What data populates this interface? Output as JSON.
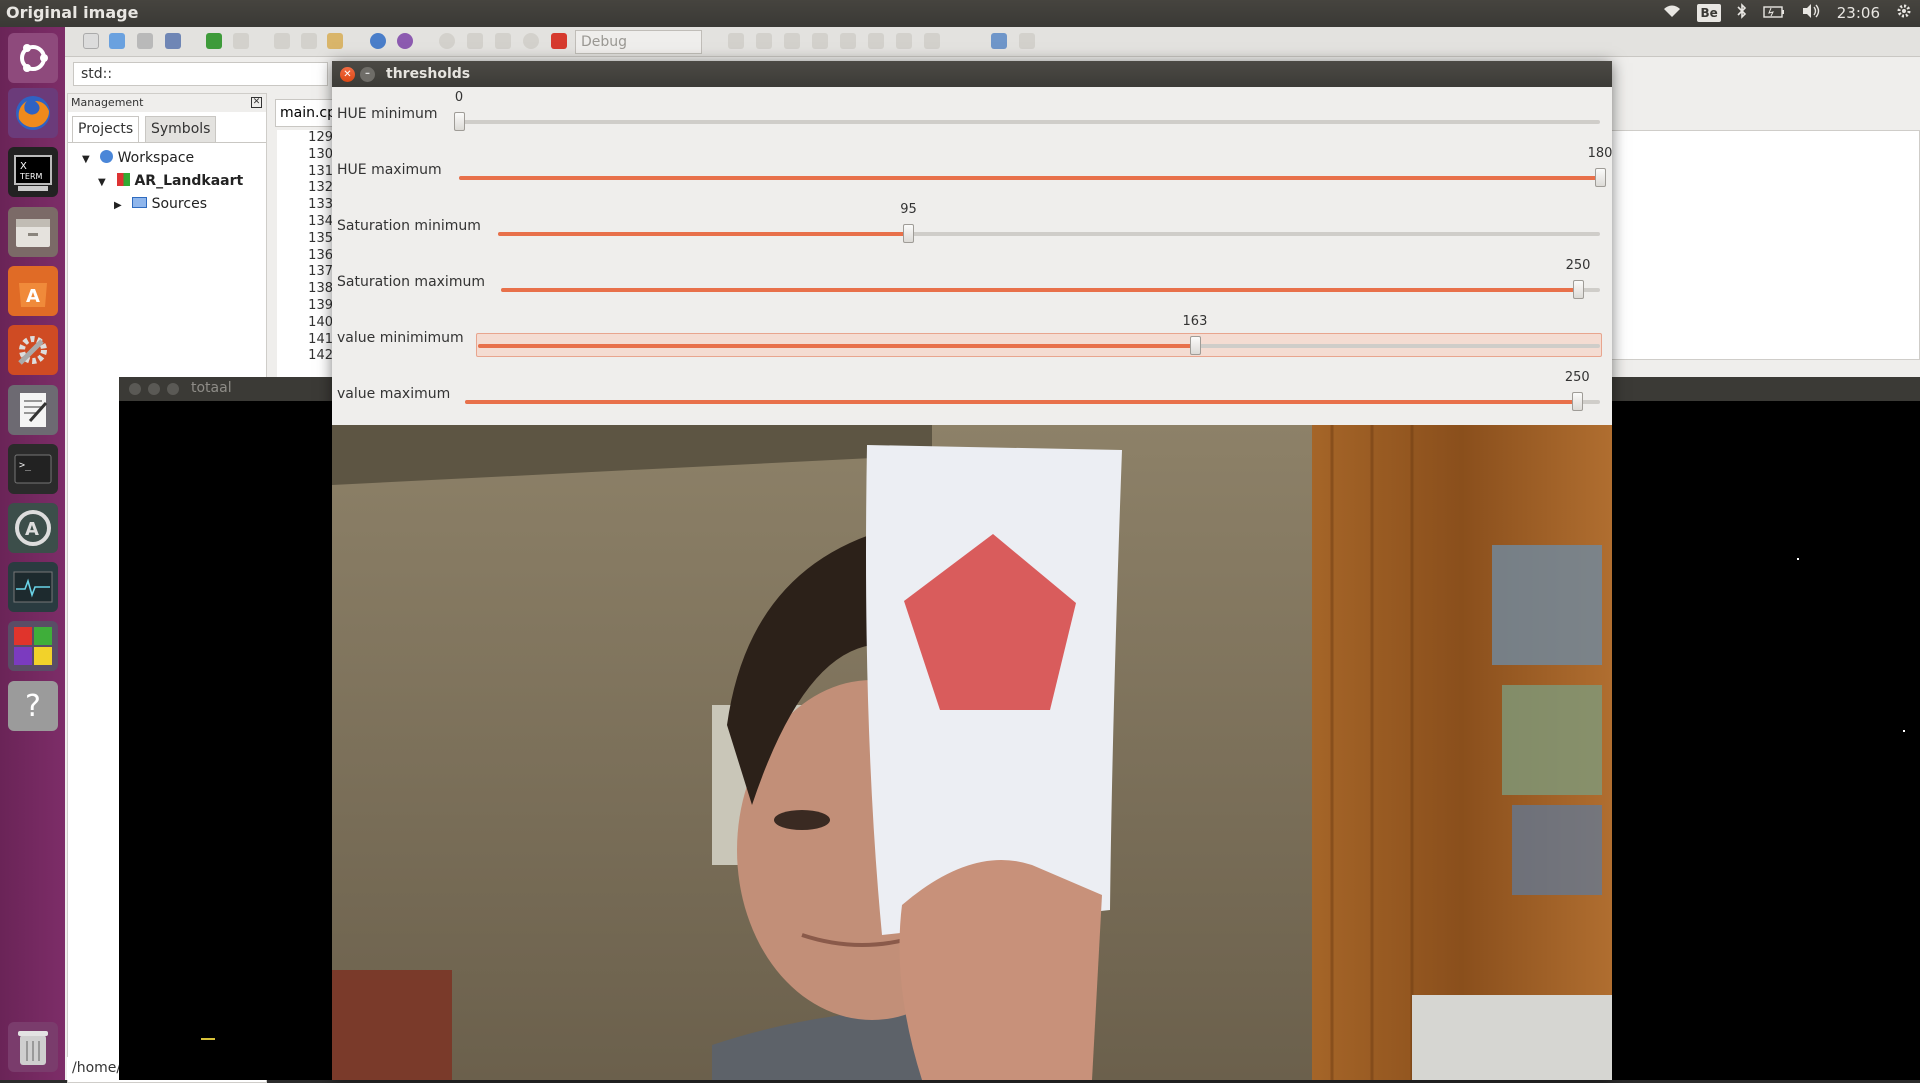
{
  "topbar": {
    "title": "Original image",
    "keyboard_layout": "Be",
    "clock": "23:06"
  },
  "launcher": {
    "items": [
      "ubuntu-logo-icon",
      "firefox-icon",
      "xterm-icon",
      "file-manager-icon",
      "software-center-icon",
      "settings-tools-icon",
      "text-editor-icon",
      "terminal-icon",
      "software-updater-icon",
      "system-monitor-icon",
      "codeblocks-icon",
      "help-icon",
      "trash-icon"
    ]
  },
  "ide": {
    "build_target": "Debug",
    "scope": "std::",
    "management": {
      "title": "Management",
      "tabs": [
        "Projects",
        "Symbols"
      ],
      "tree": {
        "workspace": "Workspace",
        "project": "AR_Landkaart",
        "folder": "Sources"
      }
    },
    "editor_tab": "main.cpp",
    "line_numbers": [
      "129",
      "130",
      "131",
      "132",
      "133",
      "134",
      "135",
      "136",
      "137",
      "138",
      "139",
      "140",
      "141",
      "142"
    ],
    "status_path": "/home/"
  },
  "totaal": {
    "title": "totaal"
  },
  "thresholds": {
    "title": "thresholds",
    "sliders": [
      {
        "label": "HUE minimum",
        "value": "0",
        "fraction": 0.0
      },
      {
        "label": "HUE maximum",
        "value": "180",
        "fraction": 1.0
      },
      {
        "label": "Saturation minimum",
        "value": "95",
        "fraction": 0.3725
      },
      {
        "label": "Saturation maximum",
        "value": "250",
        "fraction": 0.98
      },
      {
        "label": "value minimimum",
        "value": "163",
        "fraction": 0.639
      },
      {
        "label": "value maximum",
        "value": "250",
        "fraction": 0.98
      }
    ]
  },
  "colors": {
    "accent": "#e8704a",
    "launcher": "#7d2d68",
    "close_button": "#dd4814",
    "pentagon": "#d95c5c"
  }
}
